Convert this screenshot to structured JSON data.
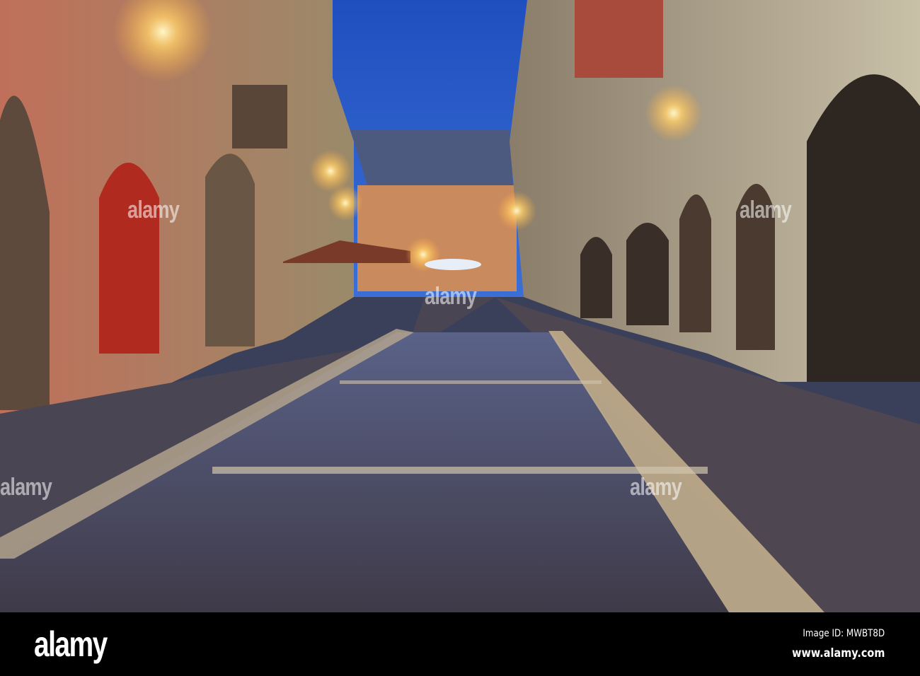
{
  "photo": {
    "subject": "Night street with arcades and cobblestones",
    "watermark": "alamy",
    "colors": {
      "sky": "#2a5bc4",
      "street": "#4a4c66",
      "lamp": "#ffd27a"
    }
  },
  "footer": {
    "logo": "alamy",
    "image_id": "Image ID: MWBT8D",
    "site": "www.alamy.com"
  }
}
